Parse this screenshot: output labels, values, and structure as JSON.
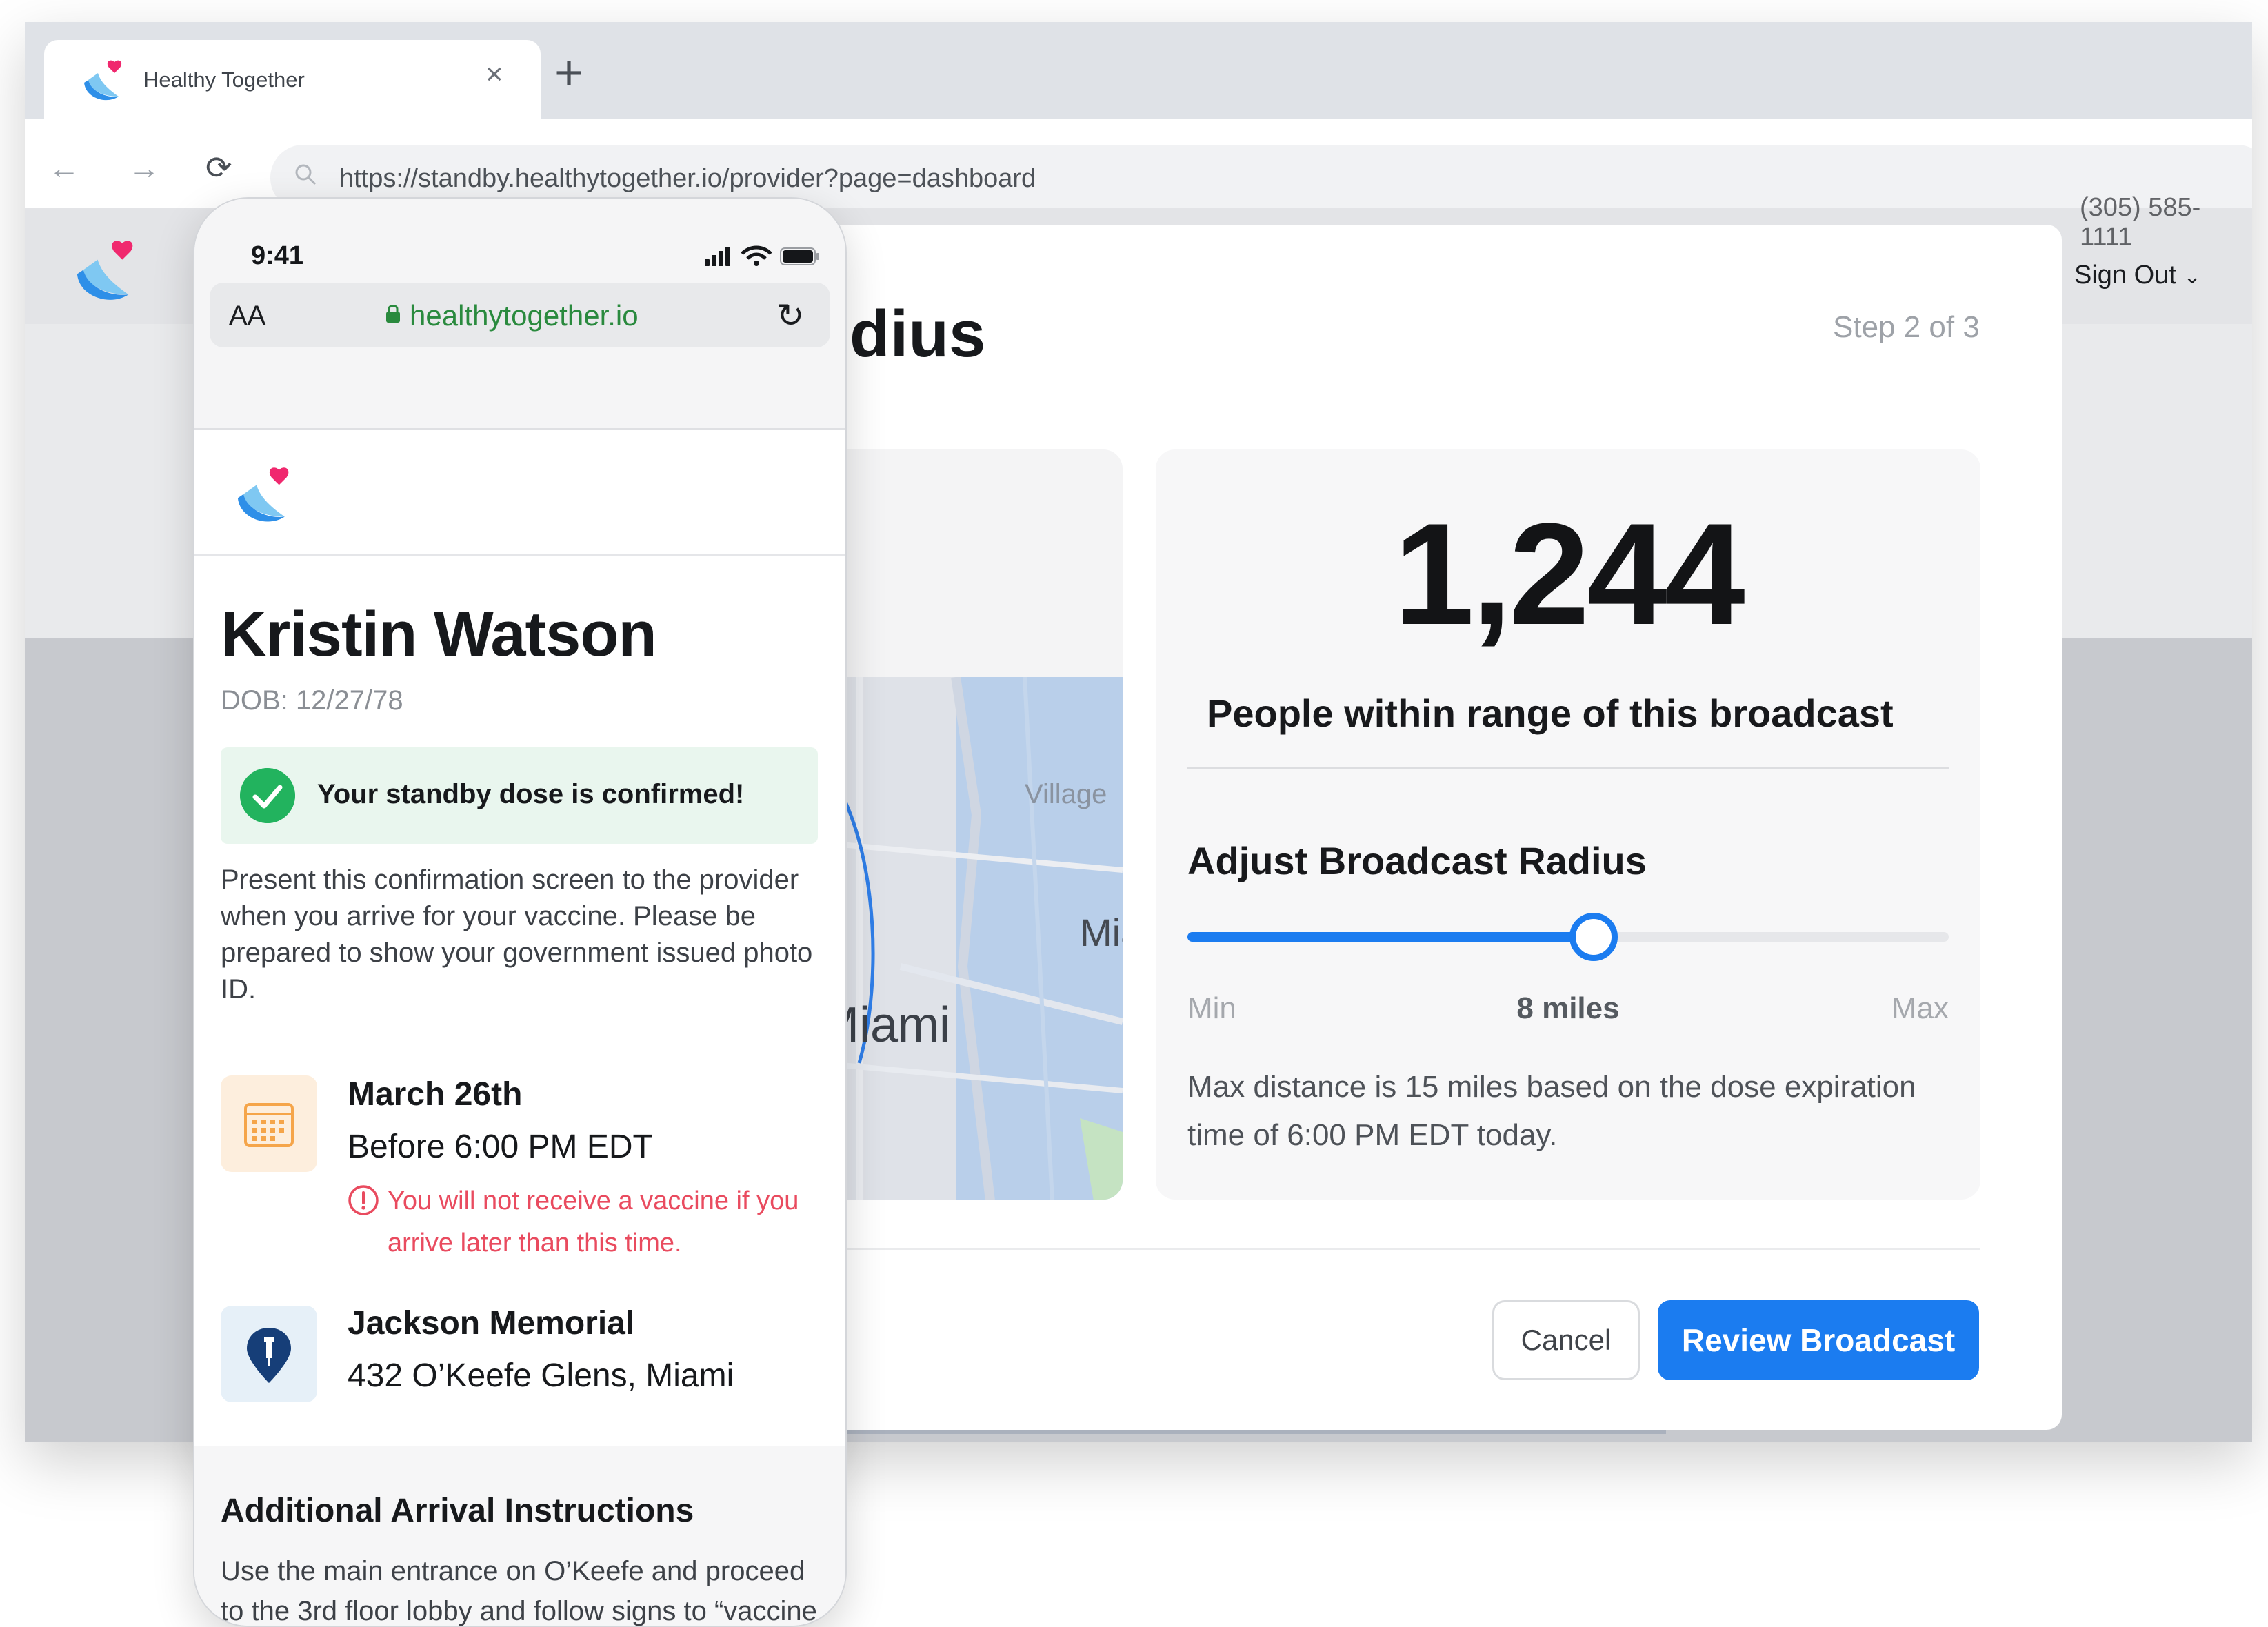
{
  "browser": {
    "tab_title": "Healthy Together",
    "tab_close": "×",
    "new_tab": "+",
    "url": "https://standby.healthytogether.io/provider?page=dashboard",
    "back": "←",
    "forward": "→",
    "reload": "⟳"
  },
  "page": {
    "phone_partial": "(305) 585-1111",
    "sign_out": "Sign Out",
    "sign_out_caret": "⌄"
  },
  "modal": {
    "title_partial": "dius",
    "step": "Step 2 of 3",
    "map_labels": {
      "village": "Village",
      "miami_partial": "Mia",
      "miami": "Miami"
    },
    "people_count": "1,244",
    "people_label": "People within range of this broadcast",
    "adjust_title": "Adjust Broadcast Radius",
    "slider": {
      "min_label": "Min",
      "value_label": "8 miles",
      "max_label": "Max",
      "value": 8,
      "max": 15
    },
    "max_distance_text": "Max distance is 15 miles based on the dose expiration time of 6:00 PM EDT today.",
    "cancel_label": "Cancel",
    "review_label": "Review Broadcast",
    "accent_color": "#1b7cf0"
  },
  "phone": {
    "time": "9:41",
    "aa": "AA",
    "url": "healthytogether.io",
    "reload": "↻",
    "name": "Kristin Watson",
    "dob": "DOB: 12/27/78",
    "confirmed": "Your standby dose is confirmed!",
    "present_text": "Present this confirmation screen to the provider when you arrive for your vaccine. Please be prepared to show your government issued photo ID.",
    "date": "March 26th",
    "before": "Before 6:00 PM EDT",
    "warning": "You will not receive a vaccine if you arrive later than this time.",
    "place": "Jackson Memorial",
    "address": "432 O’Keefe Glens, Miami",
    "additional_title": "Additional Arrival Instructions",
    "additional_text": "Use the main entrance on O’Keefe and proceed to the 3rd floor lobby and follow signs to “vaccine",
    "confirm_color": "#22b35e",
    "warning_color": "#e94b5f"
  }
}
